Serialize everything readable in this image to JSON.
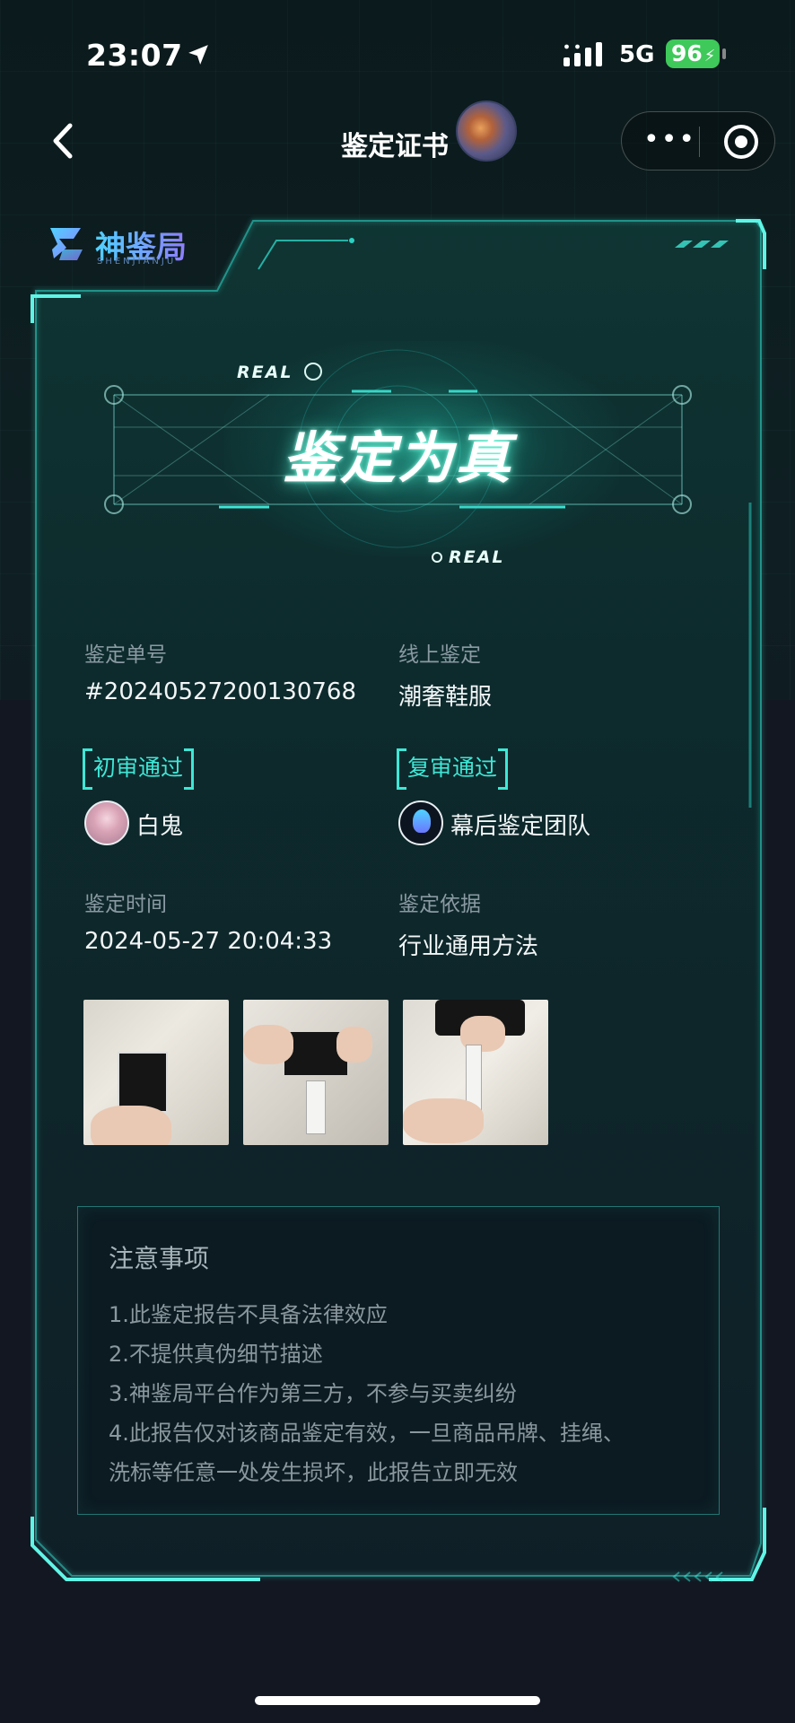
{
  "status_bar": {
    "time": "23:07",
    "network": "5G",
    "battery": "96"
  },
  "nav": {
    "title": "鉴定证书"
  },
  "brand": {
    "name": "神鉴局",
    "subtitle": "SHENJIANJU"
  },
  "hero": {
    "result": "鉴定为真",
    "tag_top": "REAL",
    "tag_bottom": "REAL"
  },
  "info": {
    "order_label": "鉴定单号",
    "order_value": "#20240527200130768",
    "type_label": "线上鉴定",
    "type_value": "潮奢鞋服",
    "first_review_badge": "初审通过",
    "first_reviewer": "白鬼",
    "second_review_badge": "复审通过",
    "second_reviewer": "幕后鉴定团队",
    "time_label": "鉴定时间",
    "time_value": "2024-05-27 20:04:33",
    "basis_label": "鉴定依据",
    "basis_value": "行业通用方法"
  },
  "photos": [
    "photo-label-front",
    "photo-care-tag",
    "photo-tag-detail"
  ],
  "notice": {
    "title": "注意事项",
    "lines": [
      "1.此鉴定报告不具备法律效应",
      "2.不提供真伪细节描述",
      "3.神鉴局平台作为第三方，不参与买卖纠纷",
      "4.此报告仅对该商品鉴定有效，一旦商品吊牌、挂绳、",
      "洗标等任意一处发生损坏，此报告立即无效"
    ]
  },
  "colors": {
    "accent": "#3ee7d6",
    "background": "#111520",
    "card_bg": "#0f2628"
  }
}
